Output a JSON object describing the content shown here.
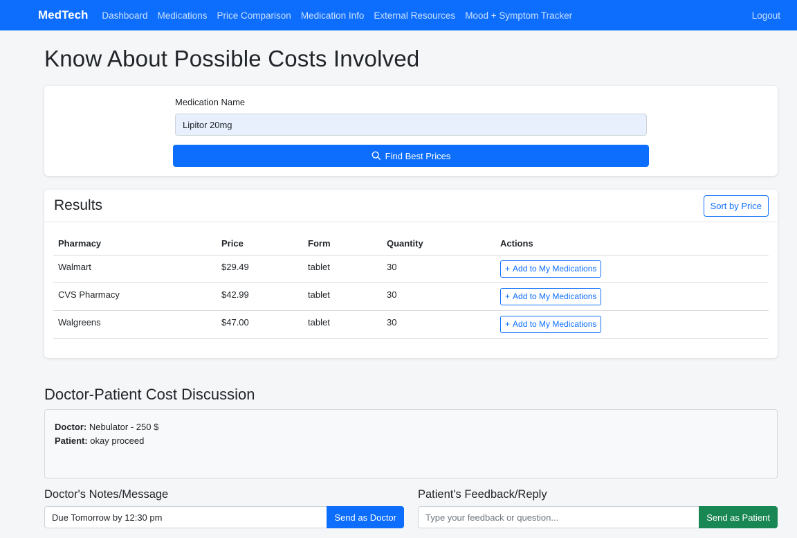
{
  "nav": {
    "brand": "MedTech",
    "links": [
      "Dashboard",
      "Medications",
      "Price Comparison",
      "Medication Info",
      "External Resources",
      "Mood + Symptom Tracker"
    ],
    "logout": "Logout"
  },
  "page": {
    "title": "Know About Possible Costs Involved"
  },
  "search": {
    "label": "Medication Name",
    "value": "Lipitor 20mg",
    "button_label": "Find Best Prices",
    "button_icon": "search-icon"
  },
  "results": {
    "title": "Results",
    "sort_label": "Sort by Price",
    "columns": [
      "Pharmacy",
      "Price",
      "Form",
      "Quantity",
      "Actions"
    ],
    "rows": [
      {
        "pharmacy": "Walmart",
        "price": "$29.49",
        "form": "tablet",
        "quantity": "30",
        "action": "Add to My Medications"
      },
      {
        "pharmacy": "CVS Pharmacy",
        "price": "$42.99",
        "form": "tablet",
        "quantity": "30",
        "action": "Add to My Medications"
      },
      {
        "pharmacy": "Walgreens",
        "price": "$47.00",
        "form": "tablet",
        "quantity": "30",
        "action": "Add to My Medications"
      }
    ]
  },
  "discussion": {
    "title": "Doctor-Patient Cost Discussion",
    "messages": [
      {
        "role": "Doctor:",
        "text": "Nebulator - 250 $"
      },
      {
        "role": "Patient:",
        "text": "okay proceed"
      }
    ]
  },
  "doctor_notes": {
    "title": "Doctor's Notes/Message",
    "value": "Due Tomorrow by 12:30 pm",
    "button_label": "Send as Doctor",
    "button_color": "#0d6efd"
  },
  "patient_feedback": {
    "title": "Patient's Feedback/Reply",
    "placeholder": "Type your feedback or question...",
    "button_label": "Send as Patient",
    "button_color": "#198754"
  }
}
